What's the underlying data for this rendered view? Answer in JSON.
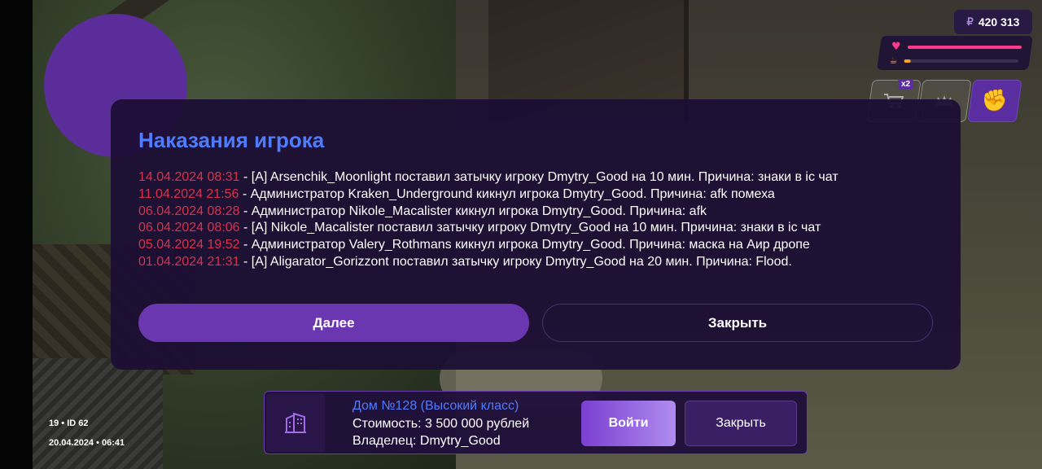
{
  "hud": {
    "money_currency": "₽",
    "money_value": "420 313",
    "health_level": 1.0,
    "food_level": 0.06,
    "shop_badge": "x2",
    "slots": [
      "shop-cart-icon",
      "crown-icon",
      "fist-icon"
    ]
  },
  "punishments": {
    "title": "Наказания игрока",
    "entries": [
      {
        "date": "14.04.2024 08:31",
        "text": " - [A] Arsenchik_Moonlight поставил затычку игроку Dmytry_Good на 10 мин. Причина: знаки в ic чат"
      },
      {
        "date": "11.04.2024 21:56",
        "text": " - Администратор Kraken_Underground кикнул игрока Dmytry_Good. Причина: afk помеха"
      },
      {
        "date": "06.04.2024 08:28",
        "text": " - Администратор Nikole_Macalister кикнул игрока Dmytry_Good. Причина: afk"
      },
      {
        "date": "06.04.2024 08:06",
        "text": " - [A] Nikole_Macalister поставил затычку игроку Dmytry_Good на 10 мин. Причина: знаки в ic чат"
      },
      {
        "date": "05.04.2024 19:52",
        "text": " - Администратор Valery_Rothmans кикнул игрока Dmytry_Good. Причина: маска на Аир дропе"
      },
      {
        "date": "01.04.2024 21:31",
        "text": " - [A] Aligarator_Gorizzont поставил затычку игроку Dmytry_Good на 20 мин. Причина: Flood."
      }
    ],
    "next_label": "Далее",
    "close_label": "Закрыть"
  },
  "house": {
    "title": "Дом №128 (Высокий класс)",
    "price": "Стоимость: 3 500 000 рублей",
    "owner": "Владелец: Dmytry_Good",
    "enter_label": "Войти",
    "close_label": "Закрыть"
  },
  "info": {
    "id_line": "19 • ID 62",
    "datetime": "20.04.2024 • 06:41"
  },
  "colors": {
    "accent_purple": "#6b37b0",
    "title_blue": "#4f7bff",
    "date_red": "#d7344a",
    "health_pink": "#ff3a8c",
    "food_orange": "#ffa21a"
  }
}
